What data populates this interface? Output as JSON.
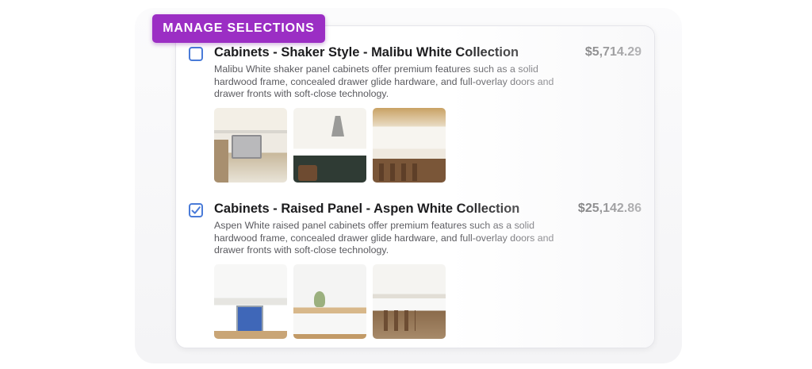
{
  "banner": {
    "label": "MANAGE SELECTIONS"
  },
  "colors": {
    "accent": "#9b2ec4",
    "checkbox": "#4a7bd8"
  },
  "items": [
    {
      "checked": false,
      "title": "Cabinets - Shaker Style - Malibu White Collection",
      "price": "$5,714.29",
      "description": "Malibu White shaker panel cabinets offer premium features such as a solid hardwood frame, concealed drawer glide hardware, and full-overlay doors and drawer fronts with soft-close technology.",
      "images": [
        "kitchen-photo",
        "kitchen-photo",
        "kitchen-photo"
      ]
    },
    {
      "checked": true,
      "title": "Cabinets - Raised Panel - Aspen White Collection",
      "price": "$25,142.86",
      "description": "Aspen White raised panel cabinets offer premium features such as a solid hardwood frame, concealed drawer glide hardware, and full-overlay doors and drawer fronts with soft-close technology.",
      "images": [
        "kitchen-photo",
        "kitchen-photo",
        "kitchen-photo"
      ]
    }
  ]
}
